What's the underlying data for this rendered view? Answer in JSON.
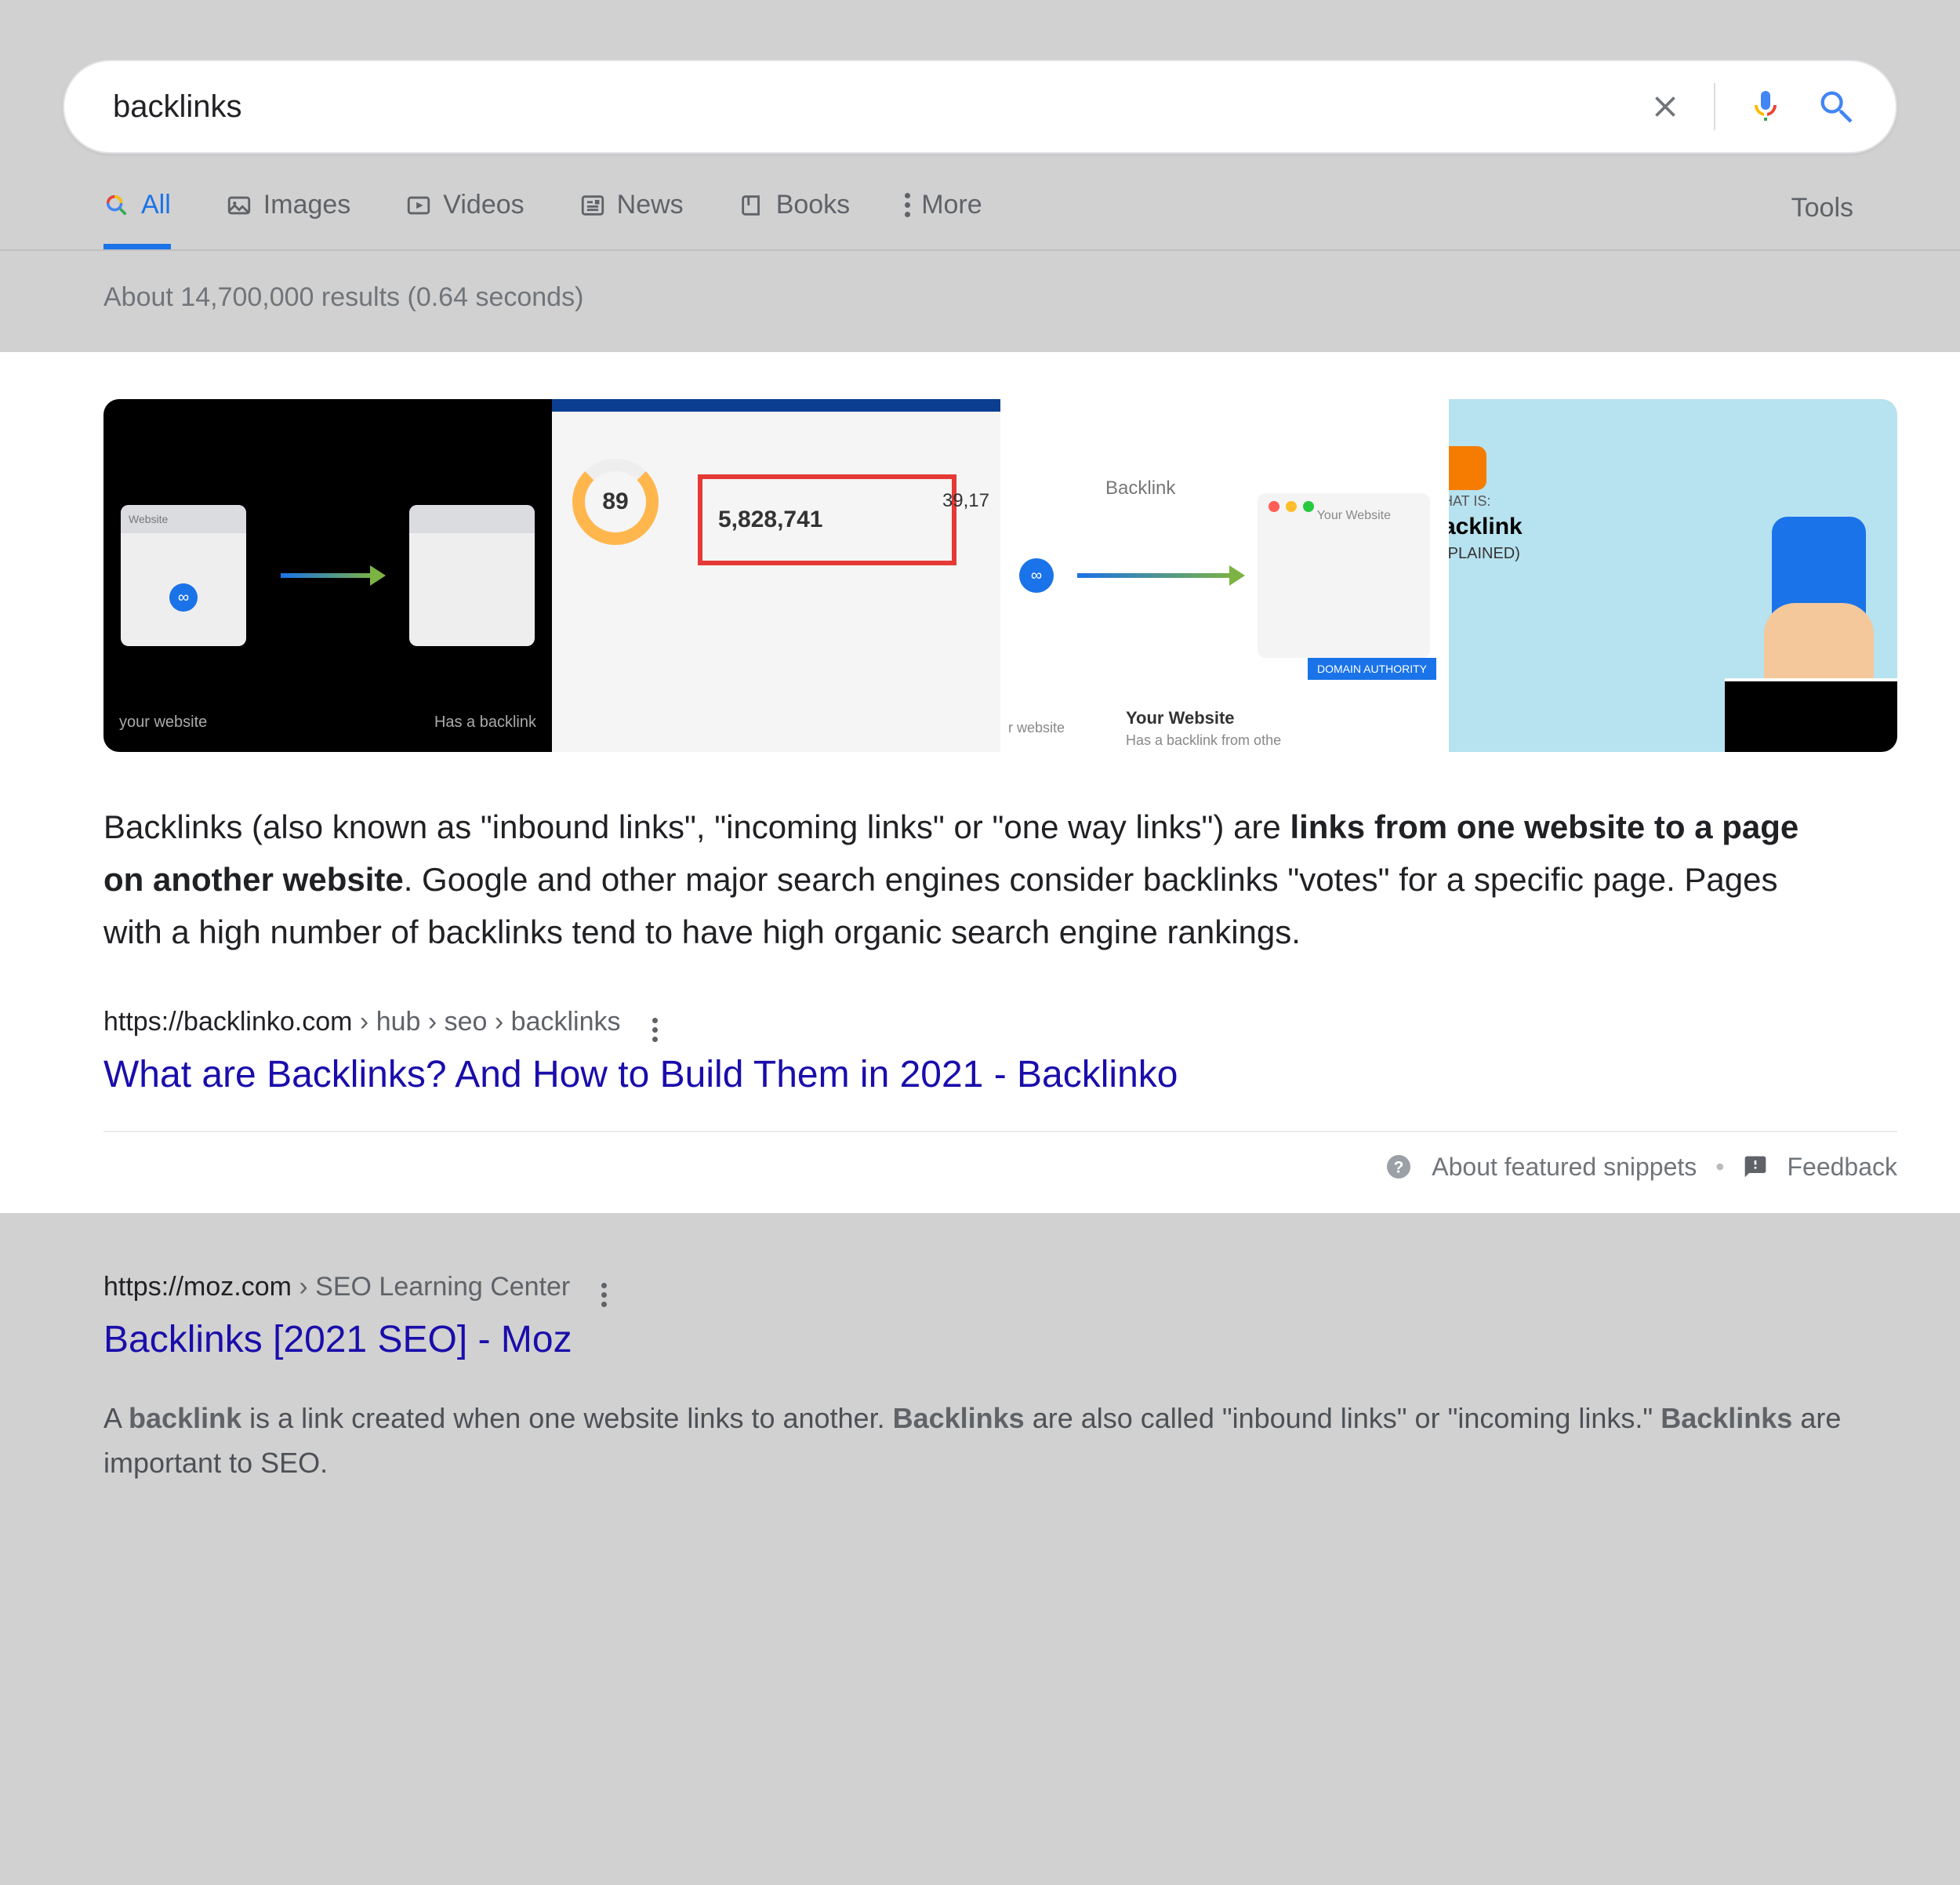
{
  "search": {
    "query": "backlinks"
  },
  "tabs": {
    "items": [
      {
        "label": "All",
        "active": true
      },
      {
        "label": "Images",
        "active": false
      },
      {
        "label": "Videos",
        "active": false
      },
      {
        "label": "News",
        "active": false
      },
      {
        "label": "Books",
        "active": false
      },
      {
        "label": "More",
        "active": false
      }
    ],
    "tools": "Tools"
  },
  "stats": "About 14,700,000 results (0.64 seconds)",
  "featured": {
    "thumbs": {
      "t1_label1": "Website",
      "t1_bottom1": "your website",
      "t1_bottom2": "Has a backlink",
      "t2_gauge": "89",
      "t2_big": "5,828,741",
      "t2_side": "39,17",
      "t3_label": "Backlink",
      "t3_caption1": "Your Website",
      "t3_caption2": "Has a backlink from othe",
      "t3_yw": "Your Website",
      "t3_da": "DOMAIN AUTHORITY",
      "t3_wlabel": "r website",
      "t4_line1": "HAT IS:",
      "t4_line2": "acklink",
      "t4_line3": "(PLAINED)"
    },
    "snippet_pre": "Backlinks (also known as \"inbound links\", \"incoming links\" or \"one way links\") are ",
    "snippet_bold": "links from one website to a page on another website",
    "snippet_post": ". Google and other major search engines consider backlinks \"votes\" for a specific page. Pages with a high number of backlinks tend to have high organic search engine rankings.",
    "breadcrumb_domain": "https://backlinko.com",
    "breadcrumb_path": " › hub › seo › backlinks",
    "title": "What are Backlinks? And How to Build Them in 2021 - Backlinko",
    "about": "About featured snippets",
    "feedback": "Feedback"
  },
  "organic": {
    "breadcrumb_domain": "https://moz.com",
    "breadcrumb_path": " › SEO Learning Center",
    "title": "Backlinks [2021 SEO] - Moz",
    "desc_1": "A ",
    "desc_b1": "backlink",
    "desc_2": " is a link created when one website links to another. ",
    "desc_b2": "Backlinks",
    "desc_3": " are also called \"inbound links\" or \"incoming links.\" ",
    "desc_b3": "Backlinks",
    "desc_4": " are important to SEO."
  }
}
